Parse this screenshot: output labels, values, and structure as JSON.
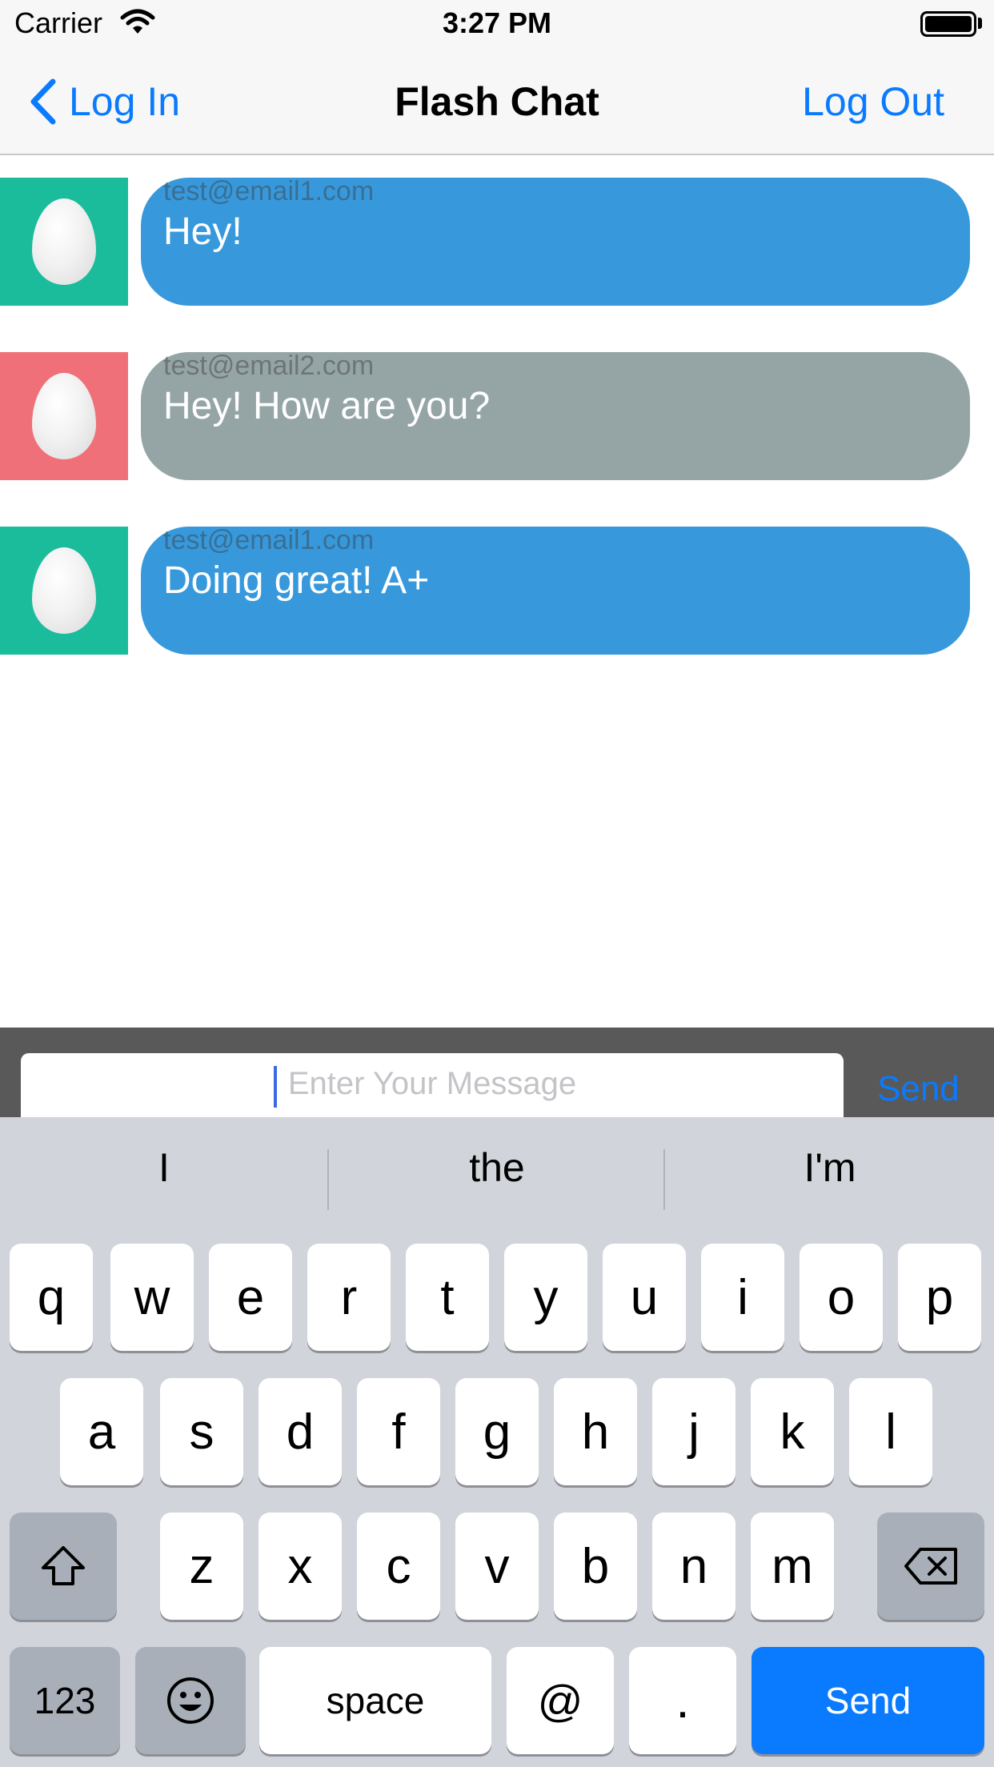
{
  "status_bar": {
    "carrier": "Carrier",
    "time": "3:27 PM"
  },
  "nav": {
    "back_label": "Log In",
    "title": "Flash Chat",
    "right_label": "Log Out"
  },
  "messages": [
    {
      "sender": "test@email1.com",
      "text": "Hey!",
      "bubble_color": "#3799dc",
      "avatar_color": "#1abc9c"
    },
    {
      "sender": "test@email2.com",
      "text": "Hey!  How are you?",
      "bubble_color": "#95a5a6",
      "avatar_color": "#f07079"
    },
    {
      "sender": "test@email1.com",
      "text": "Doing great!  A+",
      "bubble_color": "#3799dc",
      "avatar_color": "#1abc9c"
    }
  ],
  "composer": {
    "placeholder": "Enter Your Message",
    "send_label": "Send"
  },
  "keyboard": {
    "suggestions": [
      "I",
      "the",
      "I'm"
    ],
    "row1": [
      "q",
      "w",
      "e",
      "r",
      "t",
      "y",
      "u",
      "i",
      "o",
      "p"
    ],
    "row2": [
      "a",
      "s",
      "d",
      "f",
      "g",
      "h",
      "j",
      "k",
      "l"
    ],
    "row3": [
      "z",
      "x",
      "c",
      "v",
      "b",
      "n",
      "m"
    ],
    "numbers_label": "123",
    "space_label": "space",
    "at_label": "@",
    "period_label": ".",
    "return_label": "Send"
  }
}
